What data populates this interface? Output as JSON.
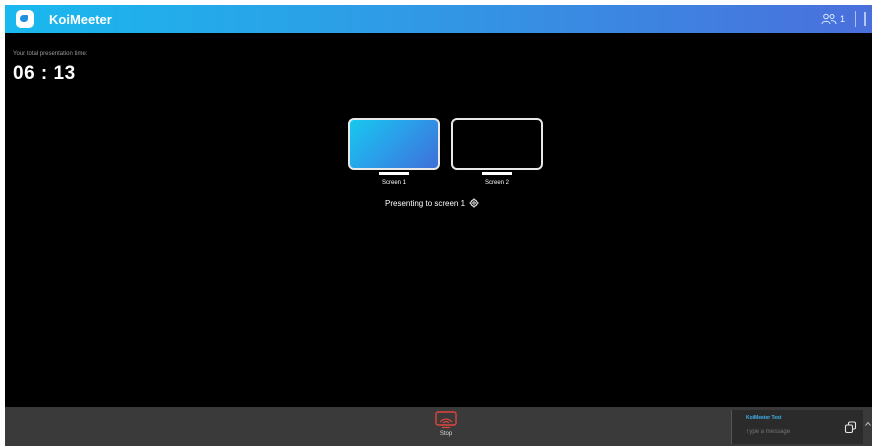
{
  "app": {
    "title": "KoiMeeter",
    "participant_count": "1"
  },
  "timer": {
    "label": "Your total presentation time:",
    "value": "06 : 13"
  },
  "screens": [
    {
      "label": "Screen 1",
      "selected": true
    },
    {
      "label": "Screen 2",
      "selected": false
    }
  ],
  "status": {
    "presenting_text": "Presenting to screen 1"
  },
  "controls": {
    "stop_label": "Stop"
  },
  "chat": {
    "title": "KoiMeeter Test",
    "placeholder": "Type a message"
  },
  "icons": {
    "logo": "koimeeter-logo",
    "participants": "people-icon",
    "settings": "gear-icon",
    "stop": "stop-cast-icon",
    "send": "send-icon",
    "expand": "chevron-up-icon"
  },
  "colors": {
    "accent": "#19b9ee",
    "stop_red": "#e0443e",
    "chat_title": "#3fb3f0"
  }
}
